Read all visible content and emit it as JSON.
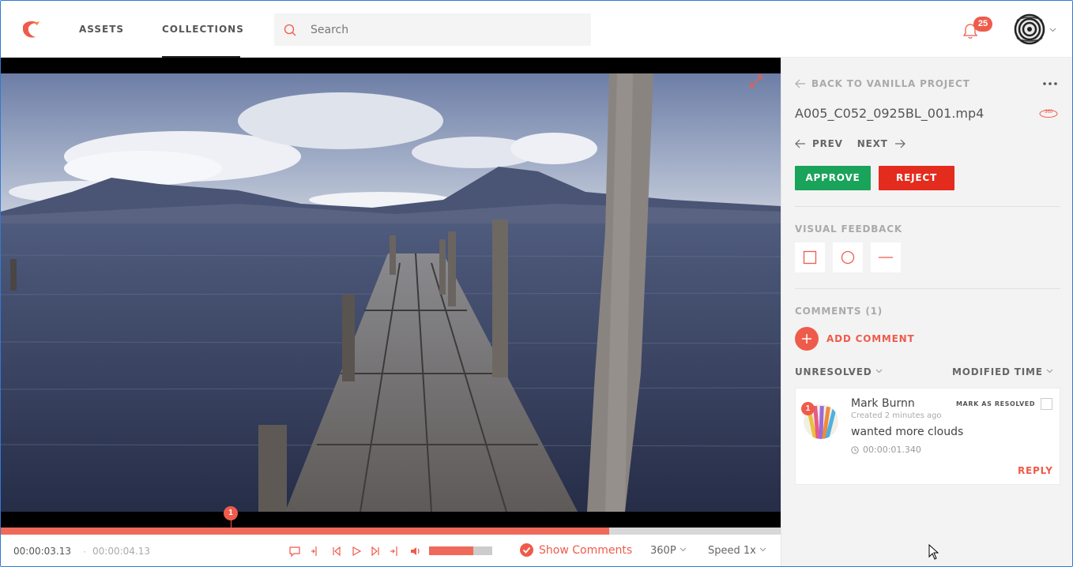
{
  "header": {
    "logo_icon": "bird-logo-icon",
    "nav": [
      {
        "label": "ASSETS"
      },
      {
        "label": "COLLECTIONS",
        "active": true
      }
    ],
    "search": {
      "placeholder": "Search",
      "value": ""
    },
    "notifications": {
      "icon": "bell-icon",
      "count": "25"
    },
    "user": {
      "avatar_icon": "user-avatar",
      "menu_icon": "chevron-down-icon"
    }
  },
  "player": {
    "expand_icon": "expand-icon",
    "comment_marker": "1",
    "progress_fraction": 0.78,
    "current_time": "00:00:03.13",
    "separator": "·",
    "total_time": "00:00:04.13",
    "controls": [
      "comment-icon",
      "mark-in-icon",
      "step-back-icon",
      "play-icon",
      "step-forward-icon",
      "mark-out-icon",
      "volume-icon"
    ],
    "volume_fraction": 0.7,
    "show_comments_label": "Show Comments",
    "show_comments_checked": true,
    "quality": "360P",
    "speed": "Speed 1x"
  },
  "panel": {
    "back_label": "BACK TO VANILLA PROJECT",
    "filename": "A005_C052_0925BL_001.mp4",
    "badge_360": "360",
    "prev_label": "PREV",
    "next_label": "NEXT",
    "approve_label": "APPROVE",
    "reject_label": "REJECT",
    "visual_feedback_label": "VISUAL FEEDBACK",
    "tools": [
      "rectangle-tool-icon",
      "circle-tool-icon",
      "line-tool-icon"
    ],
    "comments_label": "COMMENTS (1)",
    "add_comment_label": "ADD COMMENT",
    "filter_status": "UNRESOLVED",
    "filter_sort": "MODIFIED TIME",
    "comments": [
      {
        "number": "1",
        "author": "Mark Burnn",
        "created": "Created 2 minutes ago",
        "mark_resolved_label": "MARK AS RESOLVED",
        "text": "wanted more clouds",
        "timecode": "00:00:01.340",
        "reply_label": "REPLY"
      }
    ]
  },
  "colors": {
    "accent": "#ef5b4b",
    "approve": "#1aa35a",
    "reject": "#e32c1e"
  }
}
